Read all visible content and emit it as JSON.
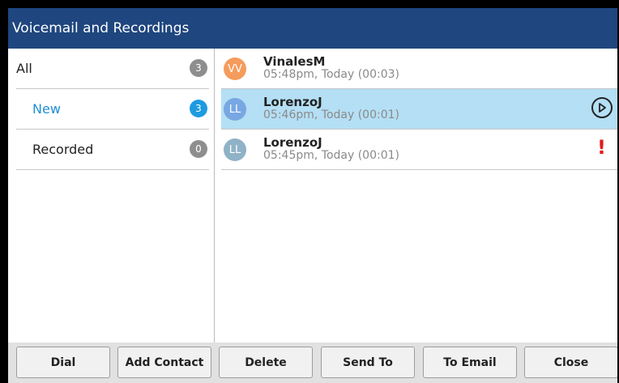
{
  "window": {
    "title": "Voicemail and Recordings"
  },
  "categories": [
    {
      "label": "All",
      "count": "3"
    },
    {
      "label": "New",
      "count": "3"
    },
    {
      "label": "Recorded",
      "count": "0"
    }
  ],
  "messages": [
    {
      "initials": "VV",
      "name": "VinalesM",
      "meta": "05:48pm, Today (00:03)",
      "avatar_color": "#f59b5c"
    },
    {
      "initials": "LL",
      "name": "LorenzoJ",
      "meta": "05:46pm, Today (00:01)",
      "avatar_color": "#78a7e3",
      "selected": true,
      "icon": "play-icon"
    },
    {
      "initials": "LL",
      "name": "LorenzoJ",
      "meta": "05:45pm, Today (00:01)",
      "avatar_color": "#8fb2c7",
      "icon": "urgent-icon",
      "urgent_mark": "!"
    }
  ],
  "buttons": {
    "dial": "Dial",
    "add_contact": "Add Contact",
    "delete": "Delete",
    "send_to": "Send To",
    "to_email": "To Email",
    "close": "Close"
  },
  "colors": {
    "titlebar": "#1f467f",
    "accent": "#1e9be0",
    "selected_row": "#b4dff4",
    "urgent": "#e11b1b"
  }
}
